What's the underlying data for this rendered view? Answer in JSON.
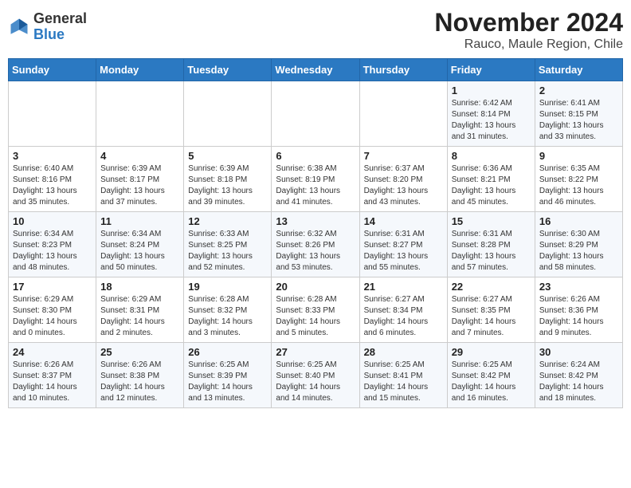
{
  "header": {
    "logo_general": "General",
    "logo_blue": "Blue",
    "title": "November 2024",
    "subtitle": "Rauco, Maule Region, Chile"
  },
  "columns": [
    "Sunday",
    "Monday",
    "Tuesday",
    "Wednesday",
    "Thursday",
    "Friday",
    "Saturday"
  ],
  "weeks": [
    [
      {
        "day": "",
        "info": ""
      },
      {
        "day": "",
        "info": ""
      },
      {
        "day": "",
        "info": ""
      },
      {
        "day": "",
        "info": ""
      },
      {
        "day": "",
        "info": ""
      },
      {
        "day": "1",
        "info": "Sunrise: 6:42 AM\nSunset: 8:14 PM\nDaylight: 13 hours\nand 31 minutes."
      },
      {
        "day": "2",
        "info": "Sunrise: 6:41 AM\nSunset: 8:15 PM\nDaylight: 13 hours\nand 33 minutes."
      }
    ],
    [
      {
        "day": "3",
        "info": "Sunrise: 6:40 AM\nSunset: 8:16 PM\nDaylight: 13 hours\nand 35 minutes."
      },
      {
        "day": "4",
        "info": "Sunrise: 6:39 AM\nSunset: 8:17 PM\nDaylight: 13 hours\nand 37 minutes."
      },
      {
        "day": "5",
        "info": "Sunrise: 6:39 AM\nSunset: 8:18 PM\nDaylight: 13 hours\nand 39 minutes."
      },
      {
        "day": "6",
        "info": "Sunrise: 6:38 AM\nSunset: 8:19 PM\nDaylight: 13 hours\nand 41 minutes."
      },
      {
        "day": "7",
        "info": "Sunrise: 6:37 AM\nSunset: 8:20 PM\nDaylight: 13 hours\nand 43 minutes."
      },
      {
        "day": "8",
        "info": "Sunrise: 6:36 AM\nSunset: 8:21 PM\nDaylight: 13 hours\nand 45 minutes."
      },
      {
        "day": "9",
        "info": "Sunrise: 6:35 AM\nSunset: 8:22 PM\nDaylight: 13 hours\nand 46 minutes."
      }
    ],
    [
      {
        "day": "10",
        "info": "Sunrise: 6:34 AM\nSunset: 8:23 PM\nDaylight: 13 hours\nand 48 minutes."
      },
      {
        "day": "11",
        "info": "Sunrise: 6:34 AM\nSunset: 8:24 PM\nDaylight: 13 hours\nand 50 minutes."
      },
      {
        "day": "12",
        "info": "Sunrise: 6:33 AM\nSunset: 8:25 PM\nDaylight: 13 hours\nand 52 minutes."
      },
      {
        "day": "13",
        "info": "Sunrise: 6:32 AM\nSunset: 8:26 PM\nDaylight: 13 hours\nand 53 minutes."
      },
      {
        "day": "14",
        "info": "Sunrise: 6:31 AM\nSunset: 8:27 PM\nDaylight: 13 hours\nand 55 minutes."
      },
      {
        "day": "15",
        "info": "Sunrise: 6:31 AM\nSunset: 8:28 PM\nDaylight: 13 hours\nand 57 minutes."
      },
      {
        "day": "16",
        "info": "Sunrise: 6:30 AM\nSunset: 8:29 PM\nDaylight: 13 hours\nand 58 minutes."
      }
    ],
    [
      {
        "day": "17",
        "info": "Sunrise: 6:29 AM\nSunset: 8:30 PM\nDaylight: 14 hours\nand 0 minutes."
      },
      {
        "day": "18",
        "info": "Sunrise: 6:29 AM\nSunset: 8:31 PM\nDaylight: 14 hours\nand 2 minutes."
      },
      {
        "day": "19",
        "info": "Sunrise: 6:28 AM\nSunset: 8:32 PM\nDaylight: 14 hours\nand 3 minutes."
      },
      {
        "day": "20",
        "info": "Sunrise: 6:28 AM\nSunset: 8:33 PM\nDaylight: 14 hours\nand 5 minutes."
      },
      {
        "day": "21",
        "info": "Sunrise: 6:27 AM\nSunset: 8:34 PM\nDaylight: 14 hours\nand 6 minutes."
      },
      {
        "day": "22",
        "info": "Sunrise: 6:27 AM\nSunset: 8:35 PM\nDaylight: 14 hours\nand 7 minutes."
      },
      {
        "day": "23",
        "info": "Sunrise: 6:26 AM\nSunset: 8:36 PM\nDaylight: 14 hours\nand 9 minutes."
      }
    ],
    [
      {
        "day": "24",
        "info": "Sunrise: 6:26 AM\nSunset: 8:37 PM\nDaylight: 14 hours\nand 10 minutes."
      },
      {
        "day": "25",
        "info": "Sunrise: 6:26 AM\nSunset: 8:38 PM\nDaylight: 14 hours\nand 12 minutes."
      },
      {
        "day": "26",
        "info": "Sunrise: 6:25 AM\nSunset: 8:39 PM\nDaylight: 14 hours\nand 13 minutes."
      },
      {
        "day": "27",
        "info": "Sunrise: 6:25 AM\nSunset: 8:40 PM\nDaylight: 14 hours\nand 14 minutes."
      },
      {
        "day": "28",
        "info": "Sunrise: 6:25 AM\nSunset: 8:41 PM\nDaylight: 14 hours\nand 15 minutes."
      },
      {
        "day": "29",
        "info": "Sunrise: 6:25 AM\nSunset: 8:42 PM\nDaylight: 14 hours\nand 16 minutes."
      },
      {
        "day": "30",
        "info": "Sunrise: 6:24 AM\nSunset: 8:42 PM\nDaylight: 14 hours\nand 18 minutes."
      }
    ]
  ]
}
